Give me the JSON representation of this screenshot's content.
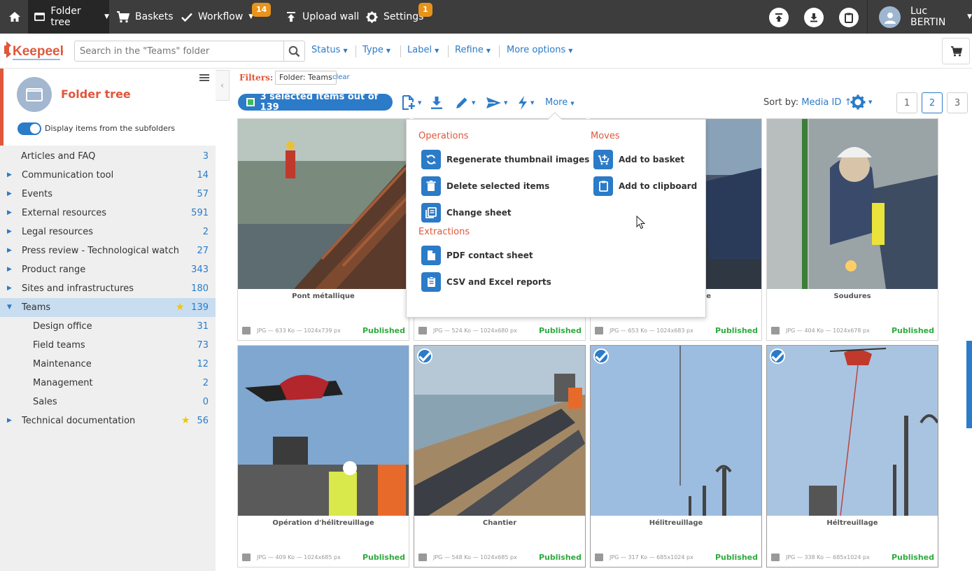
{
  "nav": {
    "folder_tree": "Folder tree",
    "baskets": "Baskets",
    "workflow": "Workflow",
    "workflow_badge": "14",
    "upload_wall": "Upload wall",
    "settings": "Settings",
    "settings_badge": "1",
    "user_name": "Luc BERTIN"
  },
  "toolbar": {
    "search_placeholder": "Search in the \"Teams\" folder",
    "status": "Status",
    "type": "Type",
    "label": "Label",
    "refine": "Refine",
    "more_options": "More options"
  },
  "sidebar": {
    "title": "Folder tree",
    "toggle_label": "Display items from the subfolders",
    "items": [
      {
        "label": "Articles and FAQ",
        "count": "3"
      },
      {
        "label": "Communication tool",
        "count": "14"
      },
      {
        "label": "Events",
        "count": "57"
      },
      {
        "label": "External resources",
        "count": "591"
      },
      {
        "label": "Legal resources",
        "count": "2"
      },
      {
        "label": "Press review - Technological watch",
        "count": "27"
      },
      {
        "label": "Product range",
        "count": "343"
      },
      {
        "label": "Sites and infrastructures",
        "count": "180"
      },
      {
        "label": "Teams",
        "count": "139"
      },
      {
        "label": "Design office",
        "count": "31"
      },
      {
        "label": "Field teams",
        "count": "73"
      },
      {
        "label": "Maintenance",
        "count": "12"
      },
      {
        "label": "Management",
        "count": "2"
      },
      {
        "label": "Sales",
        "count": "0"
      },
      {
        "label": "Technical documentation",
        "count": "56"
      }
    ]
  },
  "filters": {
    "label": "Filters:",
    "chip": "Folder: Teams",
    "clear": "clear"
  },
  "actions": {
    "selected": "3 selected items out of 139",
    "more": "More",
    "sort_label": "Sort by:",
    "sort_value": "Media ID ↑",
    "pages": [
      "1",
      "2",
      "3"
    ]
  },
  "menu": {
    "operations_title": "Operations",
    "regenerate": "Regenerate thumbnail images",
    "delete": "Delete selected items",
    "change_sheet": "Change sheet",
    "extractions_title": "Extractions",
    "pdf": "PDF contact sheet",
    "csv": "CSV and Excel reports",
    "moves_title": "Moves",
    "add_basket": "Add to basket",
    "add_clipboard": "Add to clipboard"
  },
  "cards": [
    {
      "title": "Pont métallique",
      "meta": "JPG — 633 Ko — 1024x739 px",
      "status": "Published"
    },
    {
      "title": "",
      "meta": "JPG — 524 Ko — 1024x680 px",
      "status": "Published"
    },
    {
      "title": "e",
      "meta": "JPG — 653 Ko — 1024x683 px",
      "status": "Published"
    },
    {
      "title": "Soudures",
      "meta": "JPG — 404 Ko — 1024x678 px",
      "status": "Published"
    },
    {
      "title": "Opération d'hélitreuillage",
      "meta": "JPG — 409 Ko — 1024x685 px",
      "status": "Published"
    },
    {
      "title": "Chantier",
      "meta": "JPG — 548 Ko — 1024x685 px",
      "status": "Published"
    },
    {
      "title": "Hélitreuillage",
      "meta": "JPG — 317 Ko — 685x1024 px",
      "status": "Published"
    },
    {
      "title": "Héltreuillage",
      "meta": "JPG — 338 Ko — 685x1024 px",
      "status": "Published"
    }
  ]
}
